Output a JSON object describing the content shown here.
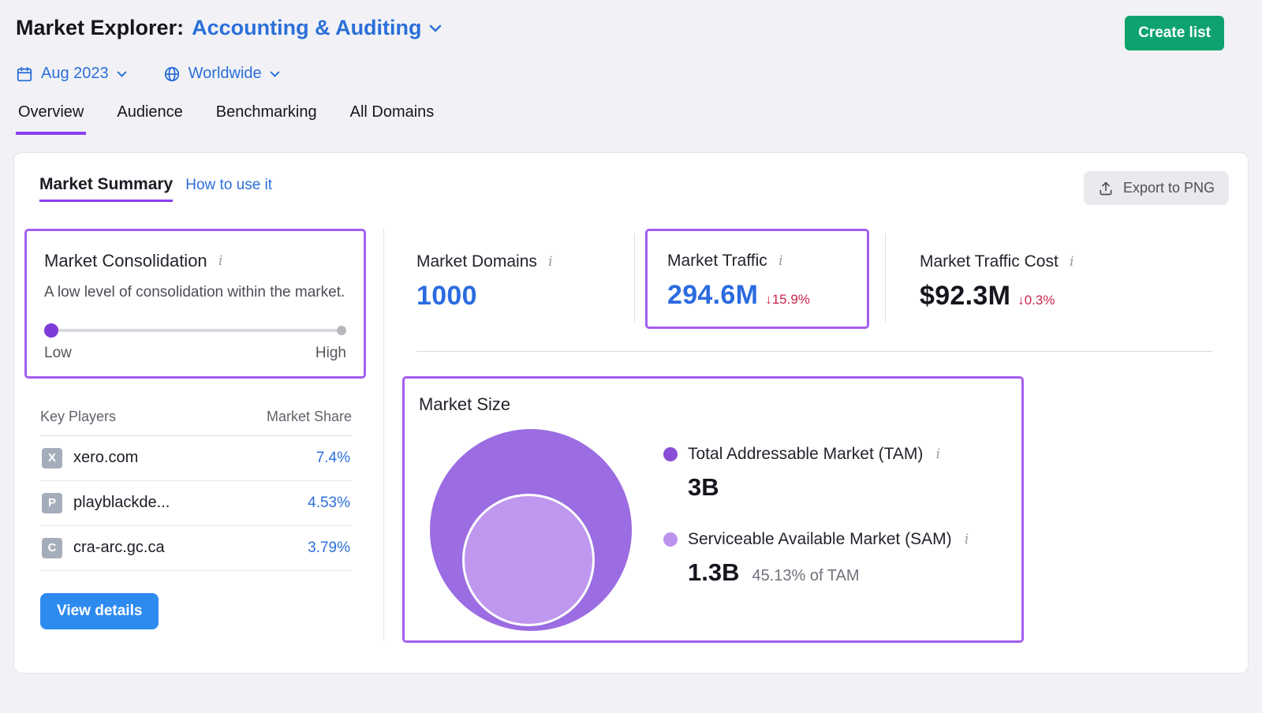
{
  "colors": {
    "highlight_purple": "#a45ef0",
    "accent_purple": "#8a3ff0",
    "link_blue": "#2b6fd9",
    "value_blue": "#2b6be0",
    "create_green": "#0ea36e",
    "negative_red": "#c8254a",
    "button_blue": "#2d8bf0",
    "tam_purple": "#9b6ce2",
    "sam_purple": "#bf97ef"
  },
  "header": {
    "title_prefix": "Market Explorer:",
    "market_name": "Accounting & Auditing",
    "create_list": "Create list",
    "date": "Aug 2023",
    "region": "Worldwide",
    "tabs": [
      {
        "label": "Overview"
      },
      {
        "label": "Audience"
      },
      {
        "label": "Benchmarking"
      },
      {
        "label": "All Domains"
      }
    ]
  },
  "summary": {
    "title": "Market Summary",
    "how_to_use": "How to use it",
    "export": "Export to PNG"
  },
  "consolidation": {
    "title": "Market Consolidation",
    "description": "A low level of consolidation within the market.",
    "low": "Low",
    "high": "High"
  },
  "key_players": {
    "header_player": "Key Players",
    "header_share": "Market Share",
    "rows": [
      {
        "initial": "X",
        "domain": "xero.com",
        "share": "7.4%"
      },
      {
        "initial": "P",
        "domain": "playblackde...",
        "share": "4.53%"
      },
      {
        "initial": "C",
        "domain": "cra-arc.gc.ca",
        "share": "3.79%"
      }
    ],
    "view_details": "View details"
  },
  "metrics": {
    "domains": {
      "label": "Market Domains",
      "value": "1000"
    },
    "traffic": {
      "label": "Market Traffic",
      "value": "294.6M",
      "change": "↓15.9%"
    },
    "cost": {
      "label": "Market Traffic Cost",
      "value": "$92.3M",
      "change": "↓0.3%"
    }
  },
  "market_size": {
    "title": "Market Size",
    "tam": {
      "label": "Total Addressable Market (TAM)",
      "value": "3B"
    },
    "sam": {
      "label": "Serviceable Available Market (SAM)",
      "value": "1.3B",
      "note": "45.13% of TAM"
    }
  }
}
